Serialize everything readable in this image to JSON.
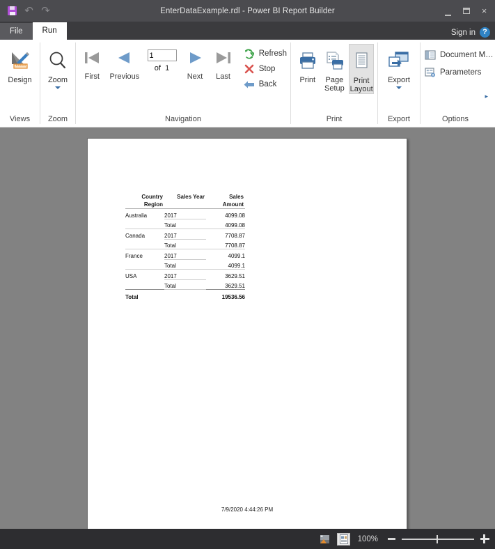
{
  "window": {
    "title": "EnterDataExample.rdl - Power BI Report Builder",
    "quick_access": {
      "save": "Save",
      "undo": "Undo",
      "redo": "Redo"
    },
    "controls": {
      "minimize": "Minimize",
      "restore": "Restore",
      "close": "×"
    }
  },
  "tabs": {
    "file": "File",
    "run": "Run",
    "signin": "Sign in",
    "help": "?"
  },
  "ribbon": {
    "groups": [
      {
        "name": "Views",
        "label": "Views"
      },
      {
        "name": "Zoom",
        "label": "Zoom"
      },
      {
        "name": "Navigation",
        "label": "Navigation"
      },
      {
        "name": "Print",
        "label": "Print"
      },
      {
        "name": "Export",
        "label": "Export"
      },
      {
        "name": "Options",
        "label": "Options"
      }
    ],
    "views": {
      "design": "Design"
    },
    "zoom": {
      "zoom": "Zoom"
    },
    "navigation": {
      "first": "First",
      "previous": "Previous",
      "next": "Next",
      "last": "Last",
      "page_value": "1",
      "of_label": "of",
      "page_total": "1",
      "refresh": "Refresh",
      "stop": "Stop",
      "back": "Back"
    },
    "print": {
      "print": "Print",
      "page_setup_line1": "Page",
      "page_setup_line2": "Setup",
      "print_layout_line1": "Print",
      "print_layout_line2": "Layout"
    },
    "export": {
      "export": "Export"
    },
    "options": {
      "document_map": "Document M…",
      "parameters": "Parameters",
      "more": "▸"
    }
  },
  "report": {
    "table": {
      "headers": [
        "Country Region",
        "Sales Year",
        "Sales Amount"
      ],
      "header_lines": [
        [
          "Country",
          "Sales Year",
          "Sales"
        ],
        [
          "Region",
          "",
          "Amount"
        ]
      ],
      "rows": [
        {
          "country": "Australia",
          "year": "2017",
          "amount": "4099.08",
          "group_start": true
        },
        {
          "country": "",
          "year": "Total",
          "amount": "4099.08",
          "group_start": false
        },
        {
          "country": "Canada",
          "year": "2017",
          "amount": "7708.87",
          "group_start": true
        },
        {
          "country": "",
          "year": "Total",
          "amount": "7708.87",
          "group_start": false
        },
        {
          "country": "France",
          "year": "2017",
          "amount": "4099.1",
          "group_start": true
        },
        {
          "country": "",
          "year": "Total",
          "amount": "4099.1",
          "group_start": false
        },
        {
          "country": "USA",
          "year": "2017",
          "amount": "3629.51",
          "group_start": true
        },
        {
          "country": "",
          "year": "Total",
          "amount": "3629.51",
          "group_start": false
        }
      ],
      "grand_total": {
        "label": "Total",
        "amount": "19536.56"
      }
    },
    "footer_timestamp": "7/9/2020 4:44:26 PM"
  },
  "statusbar": {
    "view_normal": "Normal view",
    "view_print_layout": "Print layout view",
    "zoom_level": "100%",
    "zoom_out": "Zoom out",
    "zoom_in": "Zoom in"
  },
  "colors": {
    "titlebar": "#4b4b4f",
    "tabstrip": "#3b3b3e",
    "ribbon": "#ffffff",
    "canvas": "#828282",
    "statusbar": "#2d2d30",
    "accent_blue": "#3a6ea5",
    "save_purple": "#b14fd8",
    "refresh_green": "#3fa34a",
    "stop_red": "#d9534f"
  }
}
